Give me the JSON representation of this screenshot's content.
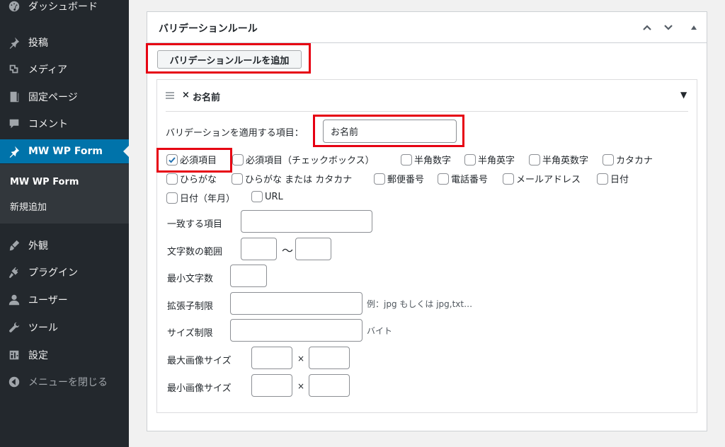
{
  "sidebar": {
    "items": [
      {
        "label": "ダッシュボード",
        "icon": "dashboard-icon"
      },
      {
        "label": "投稿",
        "icon": "pin-icon"
      },
      {
        "label": "メディア",
        "icon": "media-icon"
      },
      {
        "label": "固定ページ",
        "icon": "page-icon"
      },
      {
        "label": "コメント",
        "icon": "comment-icon"
      },
      {
        "label": "MW WP Form",
        "icon": "pin-icon",
        "active": true
      },
      {
        "label": "外観",
        "icon": "brush-icon"
      },
      {
        "label": "プラグイン",
        "icon": "plug-icon"
      },
      {
        "label": "ユーザー",
        "icon": "user-icon"
      },
      {
        "label": "ツール",
        "icon": "wrench-icon"
      },
      {
        "label": "設定",
        "icon": "settings-icon"
      },
      {
        "label": "メニューを閉じる",
        "icon": "collapse-icon"
      }
    ],
    "submenu": [
      {
        "label": "MW WP Form",
        "current": true
      },
      {
        "label": "新規追加"
      }
    ]
  },
  "postbox": {
    "title": "バリデーションルール",
    "add_button": "バリデーションルールを追加"
  },
  "rule": {
    "remove_glyph": "×",
    "name": "お名前",
    "toggle_glyph": "▼",
    "target_label": "バリデーションを適用する項目：",
    "target_value": "お名前",
    "checkboxes": [
      {
        "label": "必須項目",
        "checked": true
      },
      {
        "label": "必須項目（チェックボックス）",
        "checked": false
      },
      {
        "label": "半角数字",
        "checked": false
      },
      {
        "label": "半角英字",
        "checked": false
      },
      {
        "label": "半角英数字",
        "checked": false
      },
      {
        "label": "カタカナ",
        "checked": false
      },
      {
        "label": "ひらがな",
        "checked": false
      },
      {
        "label": "ひらがな または カタカナ",
        "checked": false
      },
      {
        "label": "郵便番号",
        "checked": false
      },
      {
        "label": "電話番号",
        "checked": false
      },
      {
        "label": "メールアドレス",
        "checked": false
      },
      {
        "label": "日付",
        "checked": false
      },
      {
        "label": "日付（年月）",
        "checked": false
      },
      {
        "label": "URL",
        "checked": false
      }
    ],
    "fields": {
      "match_label": "一致する項目",
      "length_label": "文字数の範囲",
      "range_sep": "〜",
      "min_length_label": "最小文字数",
      "ext_label": "拡張子制限",
      "ext_hint": "例：jpg もしくは jpg,txt…",
      "size_label": "サイズ制限",
      "size_hint": "バイト",
      "max_img_label": "最大画像サイズ",
      "min_img_label": "最小画像サイズ",
      "times": "×"
    }
  },
  "colors": {
    "sidebar_bg": "#23282d",
    "active_bg": "#0073aa",
    "highlight": "#e60012",
    "check": "#2271b1"
  }
}
